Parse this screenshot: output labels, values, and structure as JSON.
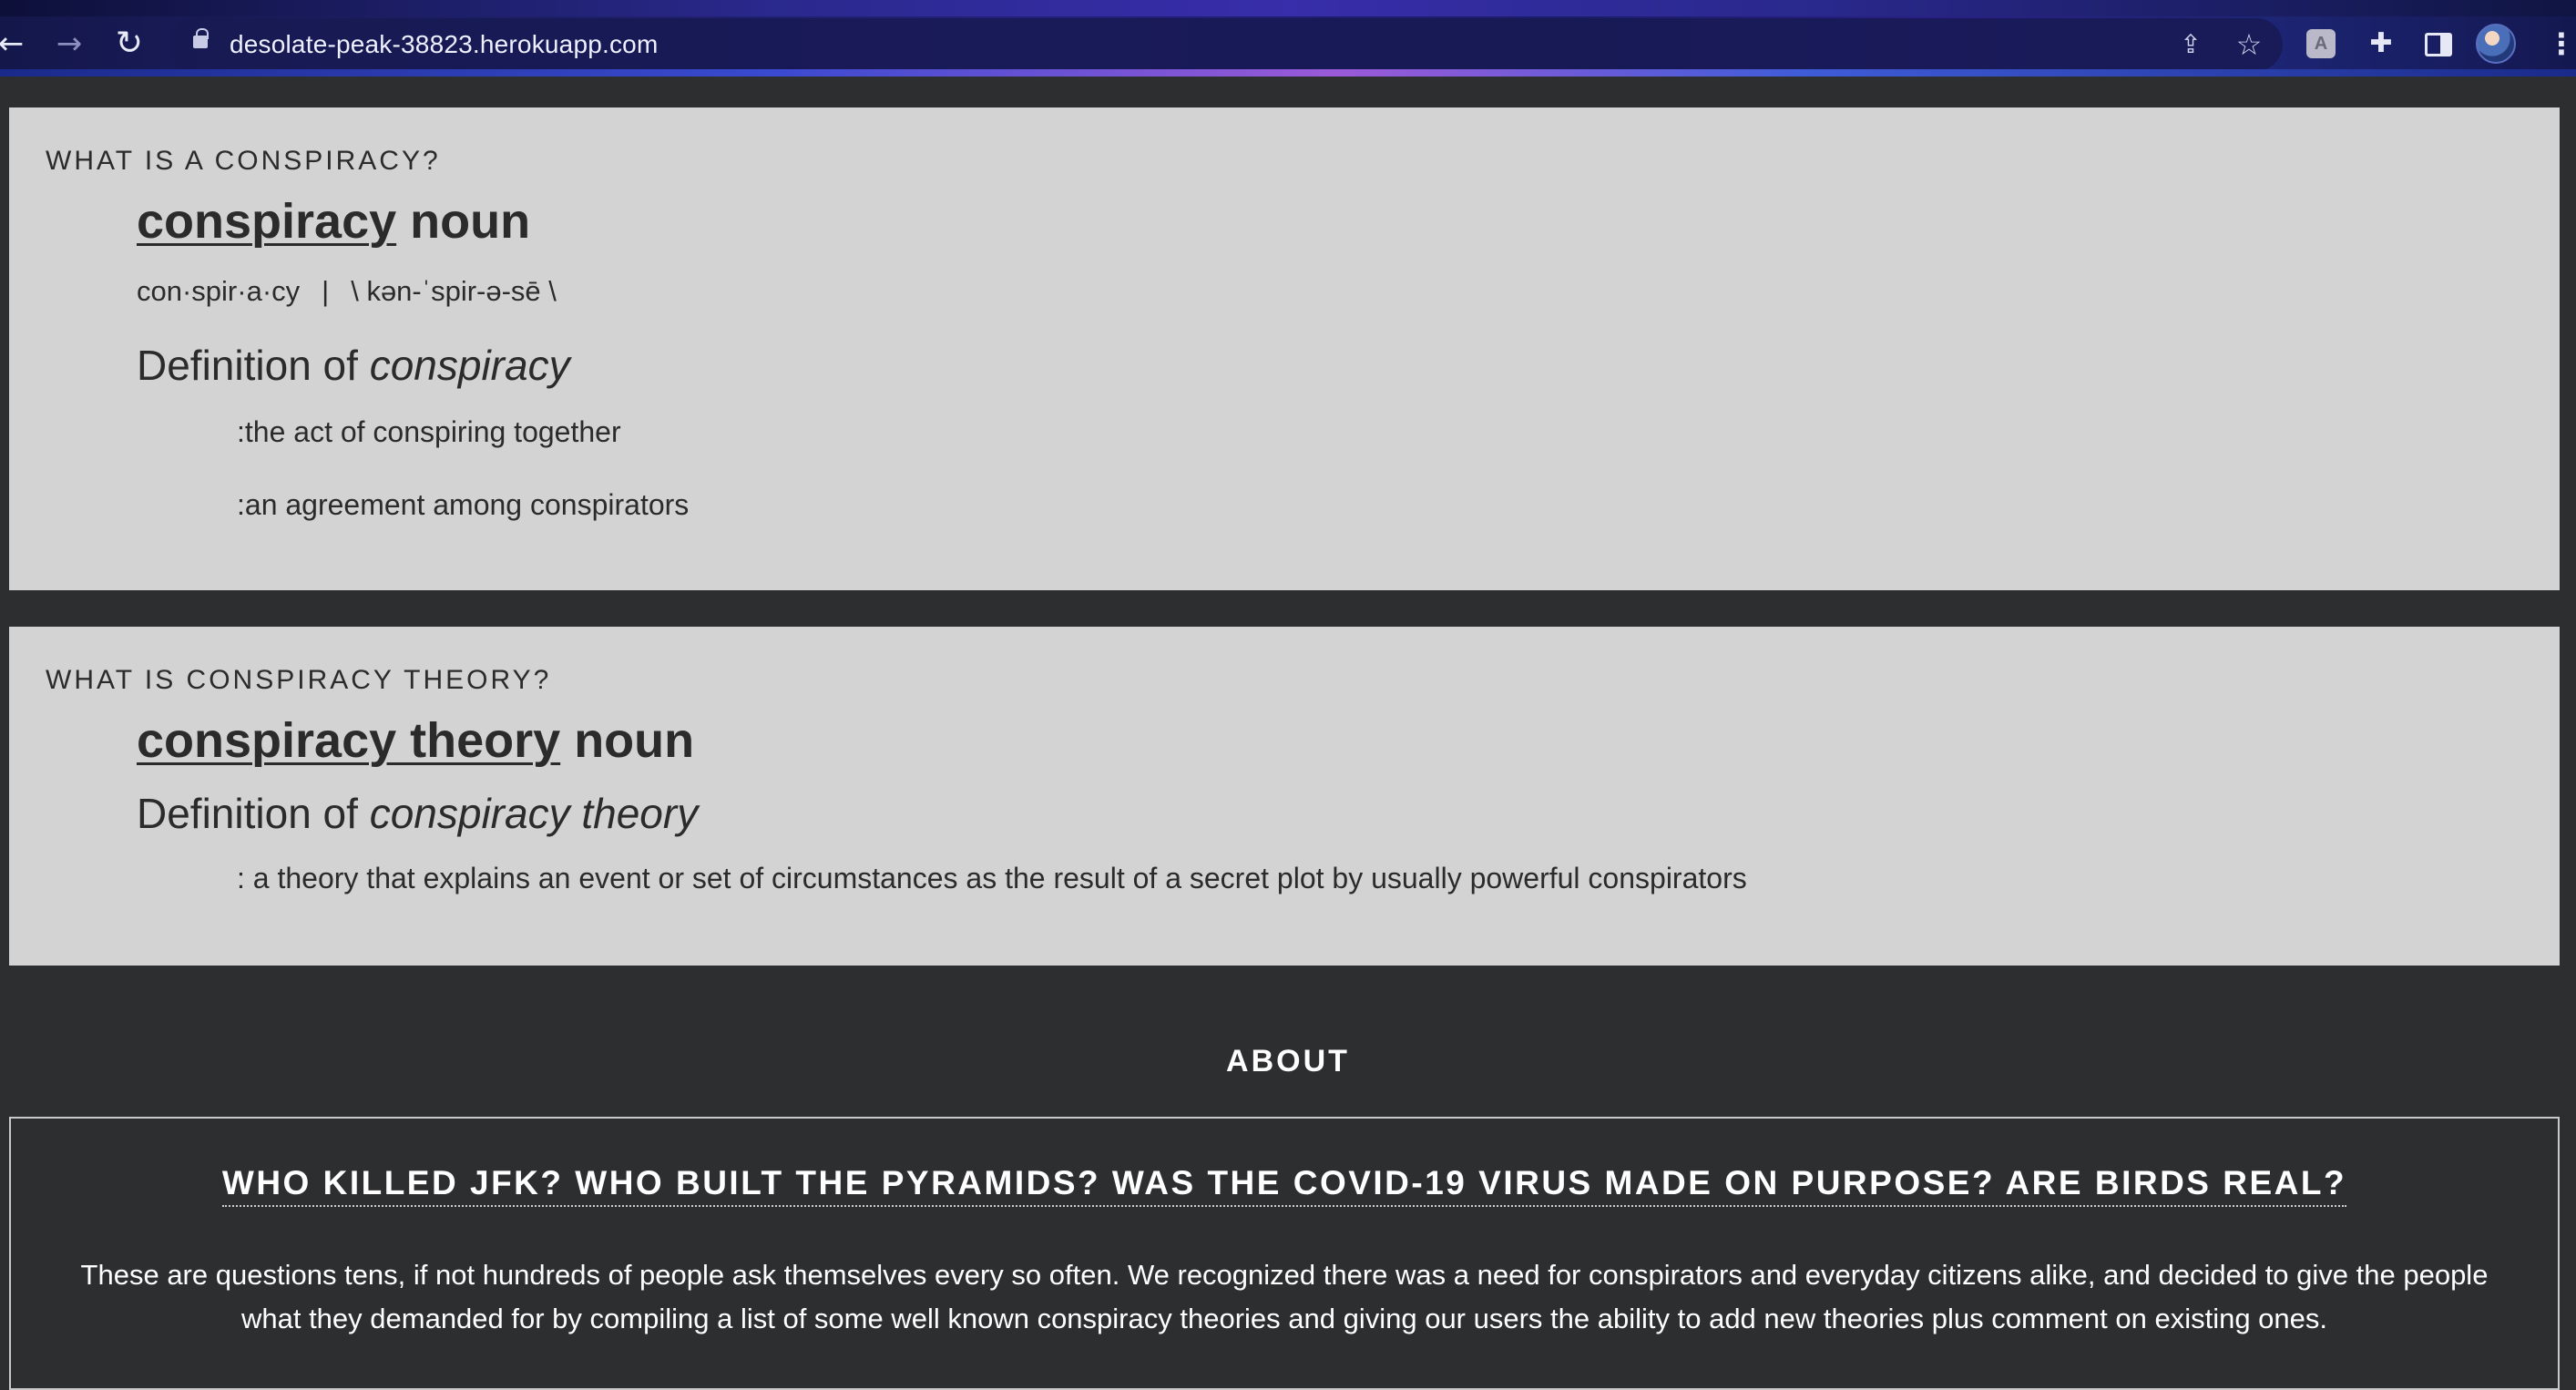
{
  "browser": {
    "url": "desolate-peak-38823.herokuapp.com",
    "icons": {
      "back": "arrow-left-icon",
      "forward": "arrow-right-icon",
      "reload": "reload-icon",
      "share": "share-icon",
      "bookmark": "star-icon",
      "extension": "extension-badge-icon",
      "extensions_menu": "puzzle-icon",
      "side_panel": "side-panel-icon",
      "profile": "avatar-icon",
      "menu": "kebab-menu-icon"
    },
    "glyphs": {
      "back": "←",
      "forward": "→",
      "reload": "↻",
      "share": "⇪",
      "bookmark": "☆",
      "extension": "A",
      "extensions_menu": "✚",
      "menu": "⋮"
    }
  },
  "conspiracy": {
    "eyebrow": "WHAT IS A CONSPIRACY?",
    "headword": "conspiracy",
    "pos": "noun",
    "syllables": "con·spir·a·cy",
    "separator": "|",
    "pronunciation": "\\ kən-ˈspir-ə-sē \\",
    "def_prefix": "Definition of",
    "def_term": "conspiracy",
    "definitions": [
      ":the act of conspiring together",
      ":an agreement among conspirators"
    ]
  },
  "theory": {
    "eyebrow": "WHAT IS CONSPIRACY THEORY?",
    "headword": "conspiracy theory",
    "pos": "noun",
    "def_prefix": "Definition of",
    "def_term": "conspiracy theory",
    "definitions": [
      ": a theory that explains an event or set of circumstances as the result of a secret plot by usually powerful conspirators"
    ]
  },
  "about": {
    "heading": "ABOUT",
    "questions": "WHO KILLED JFK? WHO BUILT THE PYRAMIDS? WAS THE COVID-19 VIRUS MADE ON PURPOSE? ARE BIRDS REAL?",
    "text": "These are questions tens, if not hundreds of people ask themselves every so often. We recognized there was a need for conspirators and everyday citizens alike, and decided to give the people what they demanded for by compiling a list of some well known conspiracy theories and giving our users the ability to add new theories plus comment on existing ones."
  }
}
